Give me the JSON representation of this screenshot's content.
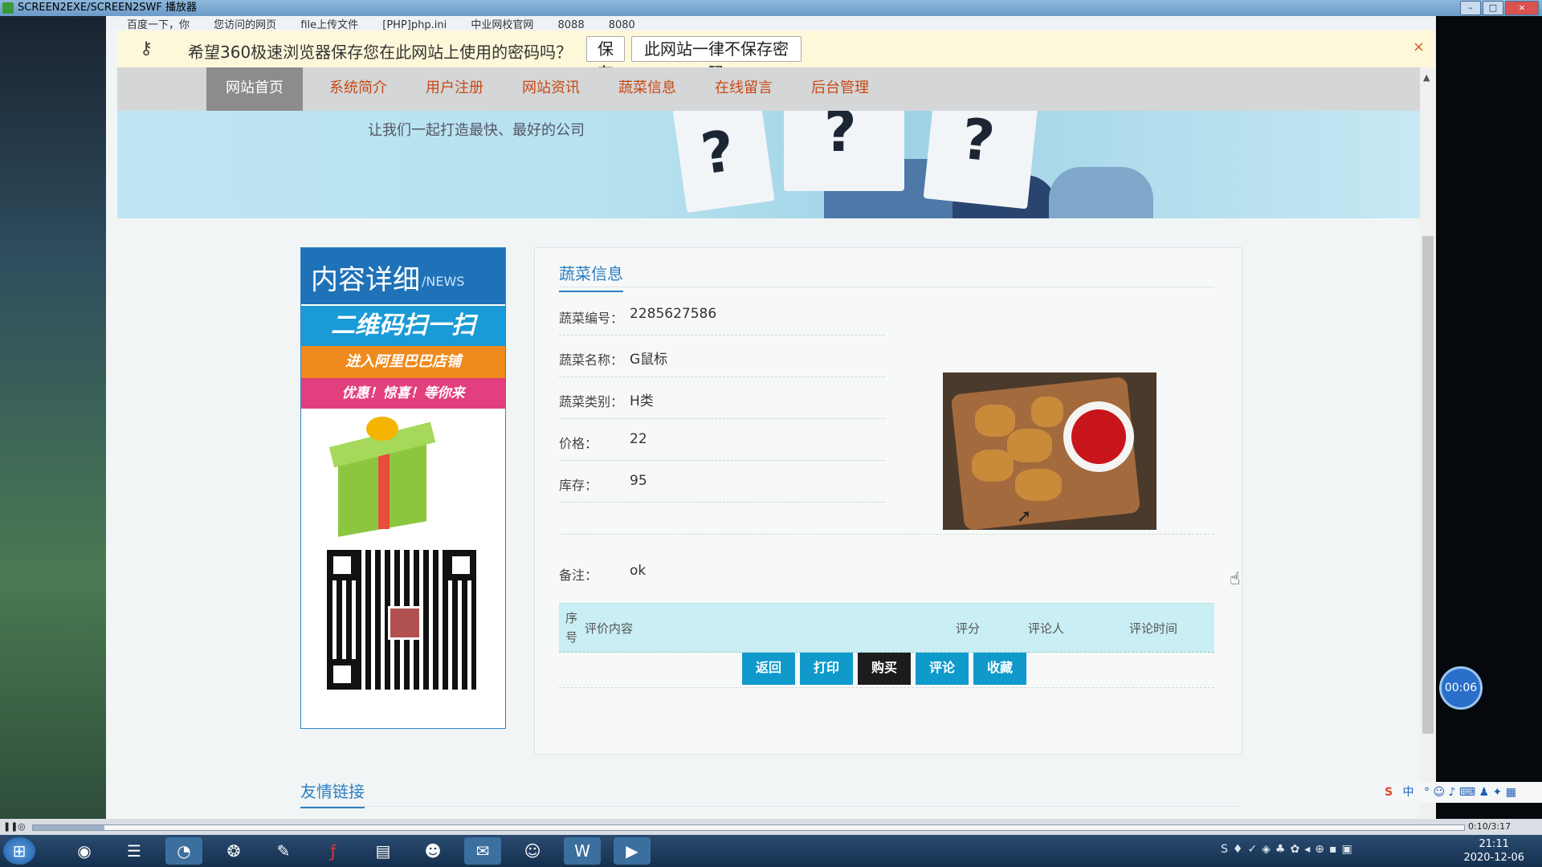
{
  "player": {
    "title": "SCREEN2EXE/SCREEN2SWF 播放器",
    "elapsed": "0:10/3:17",
    "timer": "00:06"
  },
  "browser": {
    "bookmarks": [
      "百度一下，你",
      "您访问的网页",
      "file上传文件",
      "[PHP]php.ini",
      "中业网校官网",
      "8088",
      "8080"
    ],
    "password_prompt": {
      "message": "希望360极速浏览器保存您在此网站上使用的密码吗？",
      "save_label": "保存",
      "never_label": "此网站一律不保存密码",
      "close": "×"
    }
  },
  "nav": {
    "items": [
      "网站首页",
      "系统简介",
      "用户注册",
      "网站资讯",
      "蔬菜信息",
      "在线留言",
      "后台管理"
    ],
    "active_index": 0
  },
  "banner": {
    "slogan": "让我们一起打造最快、最好的公司"
  },
  "sidebar": {
    "title": "内容详细",
    "title_en": "/NEWS",
    "promo": {
      "line1": "二维码扫一扫",
      "line2": "进入阿里巴巴店铺",
      "line3": "优惠！惊喜！等你来"
    }
  },
  "detail": {
    "section_title": "蔬菜信息",
    "fields": [
      {
        "label": "蔬菜编号：",
        "value": "2285627586"
      },
      {
        "label": "蔬菜名称：",
        "value": "G鼠标"
      },
      {
        "label": "蔬菜类别：",
        "value": "H类"
      },
      {
        "label": "价格：",
        "value": "22"
      },
      {
        "label": "库存：",
        "value": "95"
      }
    ],
    "remark_label": "备注：",
    "remark_value": "ok",
    "comments_header": {
      "index": "序号",
      "content": "评价内容",
      "score": "评分",
      "author": "评论人",
      "time": "评论时间"
    },
    "actions": [
      "返回",
      "打印",
      "购买",
      "评论",
      "收藏"
    ]
  },
  "friend_links_title": "友情链接",
  "taskbar": {
    "time": "21:11",
    "date": "2020-12-06"
  },
  "ime": {
    "label": "中"
  },
  "colors": {
    "nav_text": "#c84914",
    "accent_blue": "#2d7fc1",
    "button_blue": "#0f9acb",
    "button_dark": "#1c1c1c"
  }
}
